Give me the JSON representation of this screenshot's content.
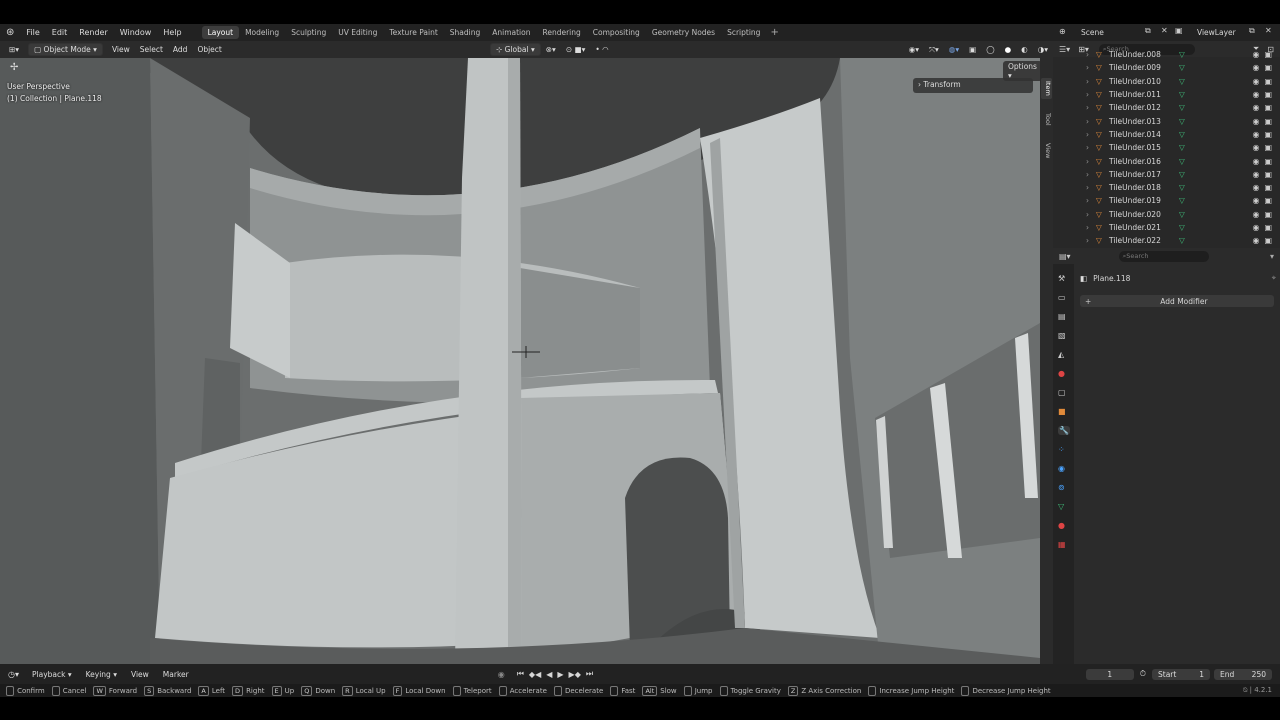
{
  "menu": [
    "File",
    "Edit",
    "Render",
    "Window",
    "Help"
  ],
  "workspaces": [
    {
      "label": "Layout",
      "active": true
    },
    {
      "label": "Modeling"
    },
    {
      "label": "Sculpting"
    },
    {
      "label": "UV Editing"
    },
    {
      "label": "Texture Paint"
    },
    {
      "label": "Shading"
    },
    {
      "label": "Animation"
    },
    {
      "label": "Rendering"
    },
    {
      "label": "Compositing"
    },
    {
      "label": "Geometry Nodes"
    },
    {
      "label": "Scripting"
    }
  ],
  "scene": {
    "name": "Scene",
    "view_layer": "ViewLayer"
  },
  "viewport_header": {
    "mode": "Object Mode",
    "menus": [
      "View",
      "Select",
      "Add",
      "Object"
    ],
    "orientation": "Global",
    "options": "Options"
  },
  "viewport": {
    "perspective": "User Perspective",
    "collection_info": "(1) Collection | Plane.118",
    "transform_label": "Transform"
  },
  "npanel_tabs": [
    "Item",
    "Tool",
    "View"
  ],
  "outliner": {
    "search_placeholder": "Search",
    "items": [
      "TileUnder.008",
      "TileUnder.009",
      "TileUnder.010",
      "TileUnder.011",
      "TileUnder.012",
      "TileUnder.013",
      "TileUnder.014",
      "TileUnder.015",
      "TileUnder.016",
      "TileUnder.017",
      "TileUnder.018",
      "TileUnder.019",
      "TileUnder.020",
      "TileUnder.021",
      "TileUnder.022"
    ]
  },
  "properties": {
    "search_placeholder": "Search",
    "object_name": "Plane.118",
    "add_modifier": "Add Modifier"
  },
  "timeline": {
    "menus": [
      "Playback",
      "Keying",
      "View",
      "Marker"
    ],
    "current_frame": "1",
    "start_label": "Start",
    "start": "1",
    "end_label": "End",
    "end": "250"
  },
  "statusbar": {
    "items": [
      {
        "key": "",
        "label": "Confirm"
      },
      {
        "key": "",
        "label": "Cancel"
      },
      {
        "key": "W",
        "label": "Forward"
      },
      {
        "key": "S",
        "label": "Backward"
      },
      {
        "key": "A",
        "label": "Left"
      },
      {
        "key": "D",
        "label": "Right"
      },
      {
        "key": "E",
        "label": "Up"
      },
      {
        "key": "Q",
        "label": "Down"
      },
      {
        "key": "R",
        "label": "Local Up"
      },
      {
        "key": "F",
        "label": "Local Down"
      },
      {
        "key": "",
        "label": "Teleport"
      },
      {
        "key": "",
        "label": "Accelerate"
      },
      {
        "key": "",
        "label": "Decelerate"
      },
      {
        "key": "",
        "label": "Fast"
      },
      {
        "key": "Alt",
        "label": "Slow"
      },
      {
        "key": "",
        "label": "Jump"
      },
      {
        "key": "",
        "label": "Toggle Gravity"
      },
      {
        "key": "Z",
        "label": "Z Axis Correction"
      },
      {
        "key": "",
        "label": "Increase Jump Height"
      },
      {
        "key": "",
        "label": "Decrease Jump Height"
      }
    ],
    "version": "4.2.1"
  },
  "colors": {
    "mesh_orange": "#e08a3a",
    "mesh_data_green": "#3fbf7a",
    "active_blue": "#4772b3"
  }
}
